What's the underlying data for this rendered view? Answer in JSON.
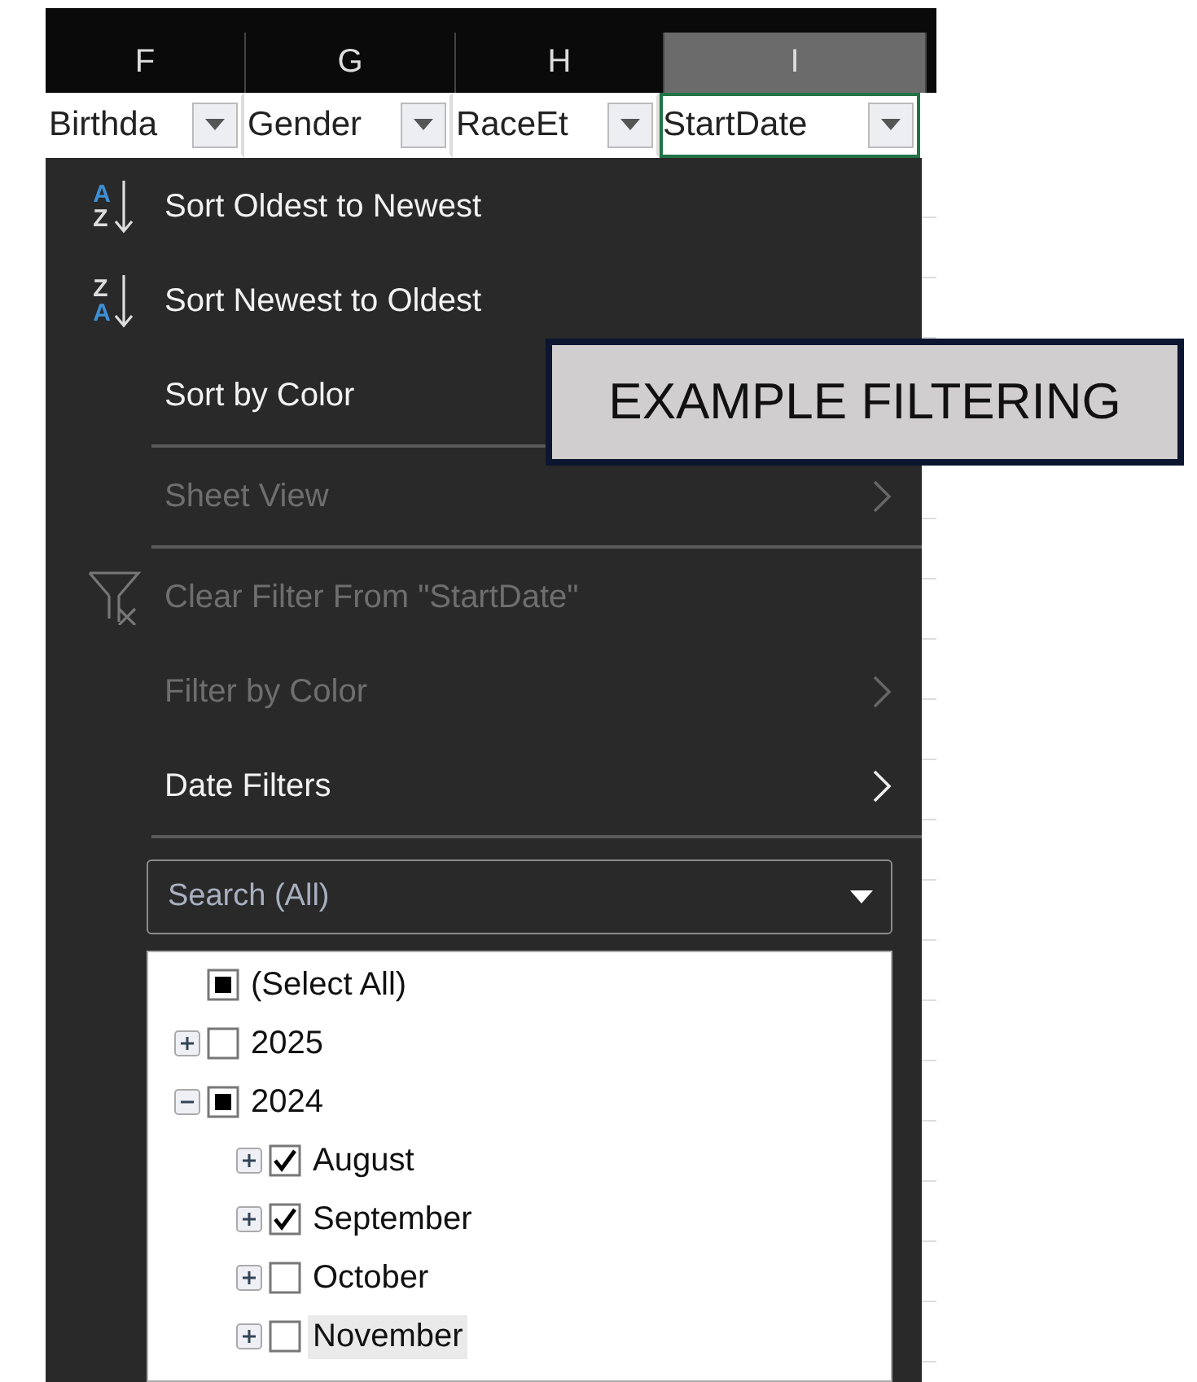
{
  "columns": [
    {
      "letter": "F",
      "selected": false
    },
    {
      "letter": "G",
      "selected": false
    },
    {
      "letter": "H",
      "selected": false
    },
    {
      "letter": "I",
      "selected": true
    }
  ],
  "header_cells": [
    {
      "text": "Birthda",
      "selected": false
    },
    {
      "text": "Gender",
      "selected": false
    },
    {
      "text": "RaceEt",
      "selected": false
    },
    {
      "text": "StartDate",
      "selected": true
    }
  ],
  "menu": {
    "items": [
      {
        "kind": "sort-asc",
        "icon_top": "A",
        "icon_bottom": "Z",
        "label": "Sort Oldest to Newest",
        "disabled": false
      },
      {
        "kind": "sort-desc",
        "icon_top": "Z",
        "icon_bottom": "A",
        "label": "Sort Newest to Oldest",
        "disabled": false
      },
      {
        "kind": "command",
        "label": "Sort by Color",
        "disabled": false
      },
      {
        "kind": "separator"
      },
      {
        "kind": "submenu",
        "label": "Sheet View",
        "disabled": true
      },
      {
        "kind": "separator"
      },
      {
        "kind": "clear-filter",
        "label": "Clear Filter From \"StartDate\"",
        "disabled": true
      },
      {
        "kind": "submenu",
        "label": "Filter by Color",
        "disabled": true
      },
      {
        "kind": "submenu",
        "label": "Date Filters",
        "disabled": false
      },
      {
        "kind": "separator"
      }
    ],
    "search": {
      "placeholder": "Search (All)"
    },
    "tree": [
      {
        "label": "(Select All)",
        "checked": false,
        "mixed": true,
        "selected": false
      },
      {
        "label": "2025",
        "checked": false,
        "mixed": false,
        "expanded": false,
        "selected": false
      },
      {
        "label": "2024",
        "checked": false,
        "mixed": true,
        "expanded": true,
        "selected": false,
        "children": [
          {
            "label": "August",
            "checked": true,
            "mixed": false,
            "expanded": false,
            "selected": false
          },
          {
            "label": "September",
            "checked": true,
            "mixed": false,
            "expanded": false,
            "selected": false
          },
          {
            "label": "October",
            "checked": false,
            "mixed": false,
            "expanded": false,
            "selected": false
          },
          {
            "label": "November",
            "checked": false,
            "mixed": false,
            "expanded": false,
            "selected": true
          }
        ]
      }
    ]
  },
  "callout": {
    "text": "EXAMPLE FILTERING"
  }
}
